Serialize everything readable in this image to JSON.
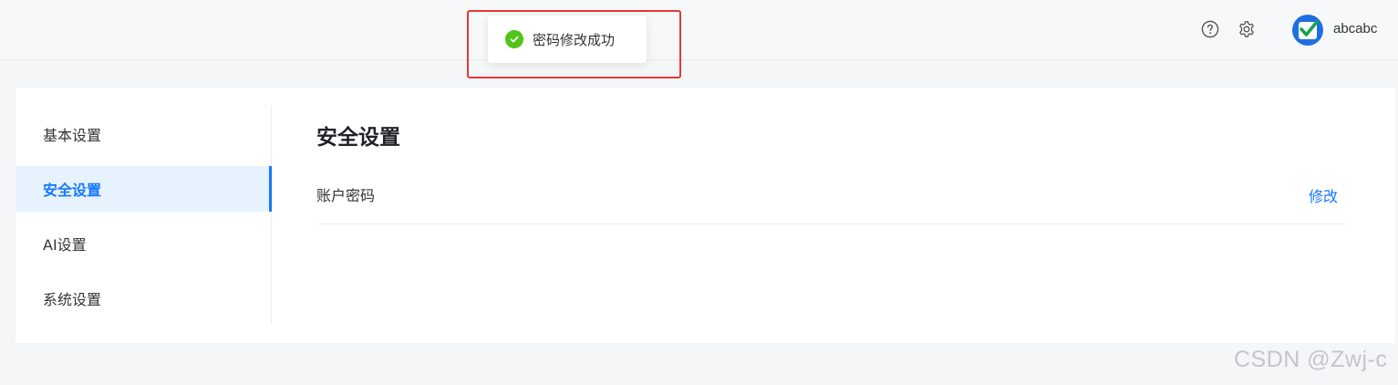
{
  "header": {
    "help_icon": "help-circle-icon",
    "settings_icon": "gear-icon",
    "username": "abcabc"
  },
  "toast": {
    "message": "密码修改成功",
    "icon": "check-circle-icon",
    "status_color": "#52c41a",
    "highlight_color": "#e53935"
  },
  "sidebar": {
    "items": [
      {
        "label": "基本设置",
        "active": false
      },
      {
        "label": "安全设置",
        "active": true
      },
      {
        "label": "AI设置",
        "active": false
      },
      {
        "label": "系统设置",
        "active": false
      }
    ]
  },
  "main": {
    "title": "安全设置",
    "rows": [
      {
        "label": "账户密码",
        "action": "修改"
      }
    ]
  },
  "watermark": "CSDN @Zwj-c",
  "colors": {
    "accent": "#1677ff",
    "active_bg": "#e6f2fe",
    "avatar_bg": "#1f6fe0"
  }
}
